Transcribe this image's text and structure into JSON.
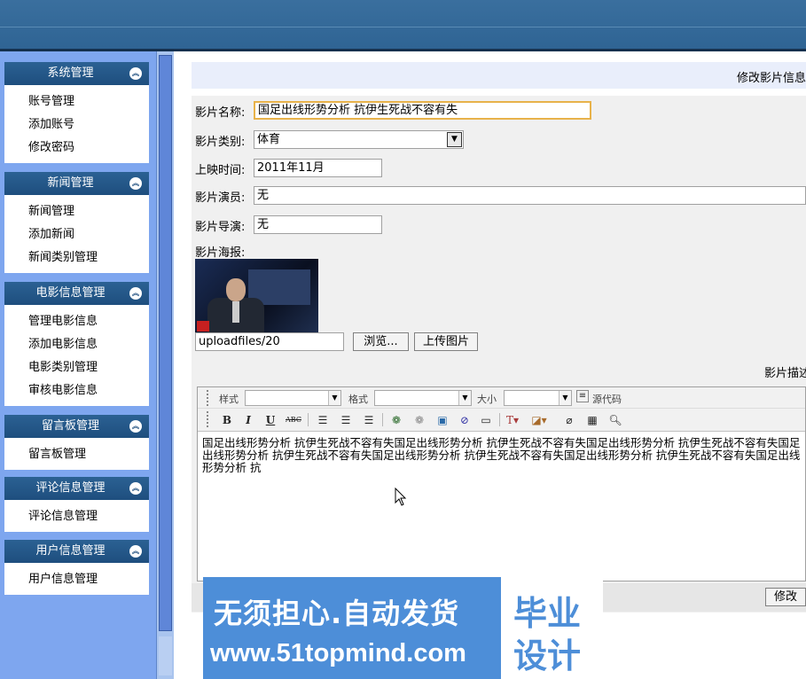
{
  "sidebar": {
    "groups": [
      {
        "title": "系统管理",
        "items": [
          "账号管理",
          "添加账号",
          "修改密码"
        ]
      },
      {
        "title": "新闻管理",
        "items": [
          "新闻管理",
          "添加新闻",
          "新闻类别管理"
        ]
      },
      {
        "title": "电影信息管理",
        "items": [
          "管理电影信息",
          "添加电影信息",
          "电影类别管理",
          "审核电影信息"
        ]
      },
      {
        "title": "留言板管理",
        "items": [
          "留言板管理"
        ]
      },
      {
        "title": "评论信息管理",
        "items": [
          "评论信息管理"
        ]
      },
      {
        "title": "用户信息管理",
        "items": [
          "用户信息管理"
        ]
      }
    ]
  },
  "page": {
    "title": "修改影片信息"
  },
  "form": {
    "name_label": "影片名称:",
    "name_value": "国足出线形势分析 抗伊生死战不容有失",
    "category_label": "影片类别:",
    "category_value": "体育",
    "date_label": "上映时间:",
    "date_value": "2011年11月",
    "actors_label": "影片演员:",
    "actors_value": "无",
    "director_label": "影片导演:",
    "director_value": "无",
    "poster_label": "影片海报:",
    "poster_path": "uploadfiles/20",
    "browse_label": "浏览...",
    "upload_label": "上传图片",
    "desc_label": "影片描述"
  },
  "editor": {
    "style_label": "样式",
    "format_label": "格式",
    "size_label": "大小",
    "source_label": "源代码",
    "content": "国足出线形势分析 抗伊生死战不容有失国足出线形势分析 抗伊生死战不容有失国足出线形势分析 抗伊生死战不容有失国足出线形势分析 抗伊生死战不容有失国足出线形势分析 抗伊生死战不容有失国足出线形势分析 抗伊生死战不容有失国足出线形势分析 抗"
  },
  "actions": {
    "submit_label": "修改"
  },
  "watermark": {
    "line1": "无须担心.自动发货",
    "line2": "www.51topmind.com",
    "badge1": "毕业",
    "badge2": "设计"
  }
}
